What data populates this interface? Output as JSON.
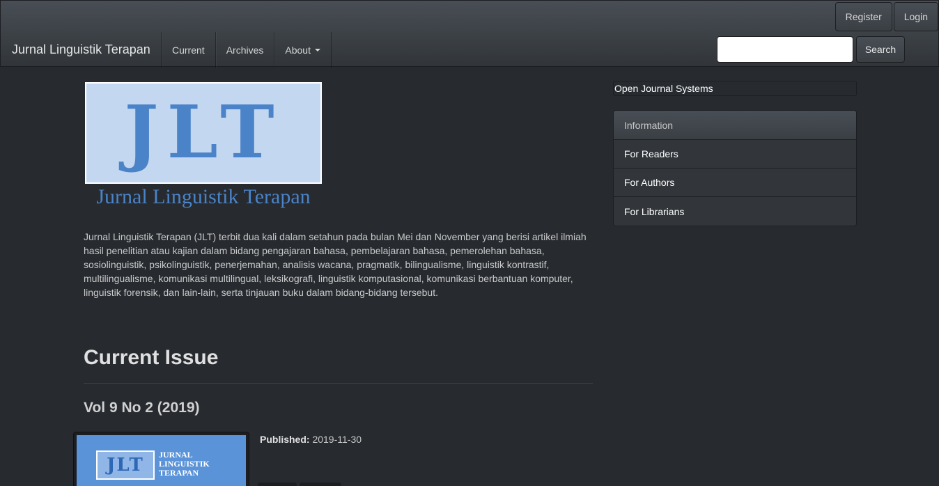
{
  "header": {
    "brand": "Jurnal Linguistik Terapan",
    "nav": [
      {
        "label": "Current"
      },
      {
        "label": "Archives"
      },
      {
        "label": "About"
      }
    ],
    "user_nav": {
      "register": "Register",
      "login": "Login"
    },
    "search": {
      "value": "",
      "button_label": "Search"
    }
  },
  "logo": {
    "letters": "JLT",
    "caption": "Jurnal Linguistik Terapan"
  },
  "main": {
    "description": "Jurnal Linguistik Terapan (JLT) terbit dua kali dalam setahun pada bulan Mei dan November yang berisi artikel ilmiah hasil penelitian atau kajian dalam bidang pengajaran bahasa, pembelajaran bahasa, pemerolehan bahasa, sosiolinguistik, psikolinguistik, penerjemahan, analisis wacana, pragmatik, bilingualisme, linguistik kontrastif, multilingualisme, komunikasi multilingual, leksikografi, linguistik komputasional, komunikasi berbantuan komputer, linguistik forensik, dan lain-lain, serta tinjauan buku dalam bidang-bidang tersebut.",
    "current_issue_heading": "Current Issue",
    "issue_title": "Vol 9 No 2 (2019)",
    "cover": {
      "letters": "JLT",
      "name_lines": [
        "JURNAL",
        "LINGUISTIK",
        "TERAPAN"
      ]
    },
    "published_label": "Published:",
    "published_date": "2019-11-30"
  },
  "sidebar": {
    "ojs_link": "Open Journal Systems",
    "info_heading": "Information",
    "info_items": [
      {
        "label": "For Readers"
      },
      {
        "label": "For Authors"
      },
      {
        "label": "For Librarians"
      }
    ]
  }
}
